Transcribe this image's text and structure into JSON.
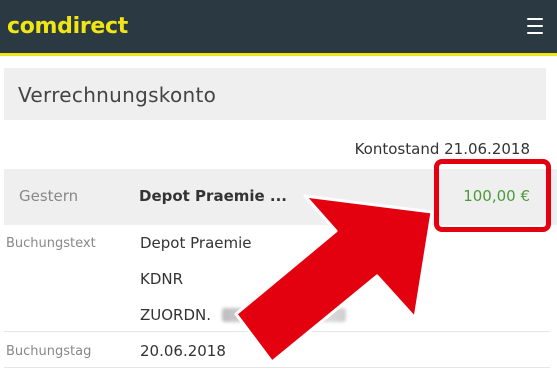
{
  "header": {
    "logo": "comdirect",
    "menu_icon": "hamburger-menu-icon"
  },
  "page": {
    "title": "Verrechnungskonto",
    "balance_label": "Kontostand 21.06.2018"
  },
  "transaction": {
    "date": "Gestern",
    "name": "Depot Praemie ...",
    "amount": "100,00 €"
  },
  "details": {
    "buchungstext_label": "Buchungstext",
    "buchungstext_line1": "Depot Praemie",
    "buchungstext_line2": "KDNR",
    "buchungstext_line3": "ZUORDN.",
    "buchungstag_label": "Buchungstag",
    "buchungstag_value": "20.06.2018"
  },
  "colors": {
    "header_bg": "#2b3a42",
    "brand_yellow": "#f0e615",
    "amount_green": "#4a9a3c",
    "annotation_red": "#e3000f"
  }
}
